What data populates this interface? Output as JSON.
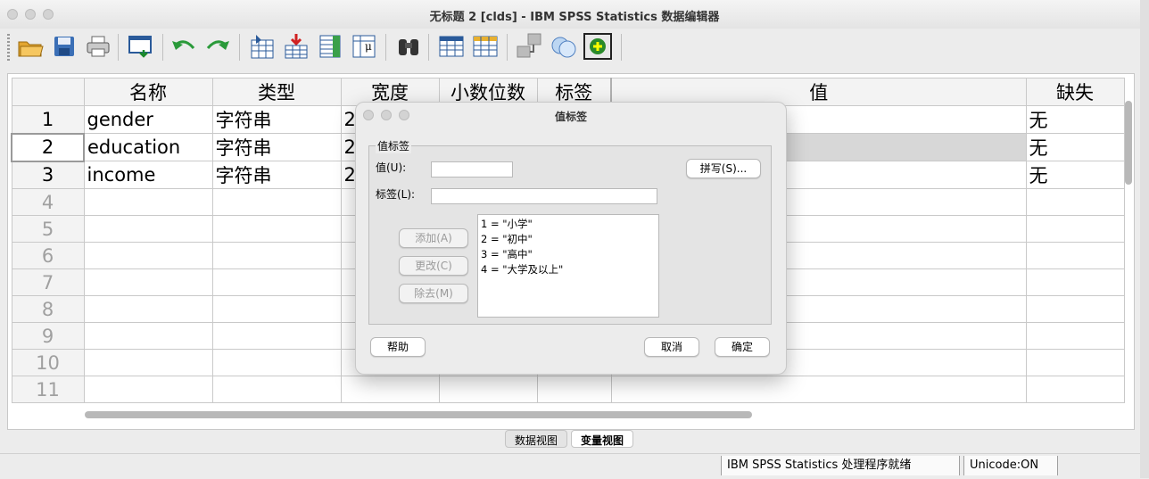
{
  "window": {
    "title": "无标题 2 [clds] - IBM SPSS Statistics 数据编辑器"
  },
  "toolbar": {
    "icons": [
      "open-folder-icon",
      "save-icon",
      "print-icon",
      "recall-dialog-icon",
      "undo-icon",
      "redo-icon",
      "goto-case-icon",
      "goto-variable-icon",
      "variables-icon",
      "run-descriptives-icon",
      "find-icon",
      "insert-cases-icon",
      "insert-variable-icon",
      "split-file-icon",
      "weight-cases-icon",
      "select-cases-icon",
      "value-labels-icon",
      "use-sets-icon"
    ]
  },
  "grid": {
    "headers": [
      "名称",
      "类型",
      "宽度",
      "小数位数",
      "标签",
      "值",
      "缺失"
    ],
    "rows": [
      {
        "num": "1",
        "name": "gender",
        "type": "字符串",
        "width": "2",
        "missing": "无"
      },
      {
        "num": "2",
        "name": "education",
        "type": "字符串",
        "width": "2",
        "missing": "无"
      },
      {
        "num": "3",
        "name": "income",
        "type": "字符串",
        "width": "2",
        "missing": "无"
      },
      {
        "num": "4"
      },
      {
        "num": "5"
      },
      {
        "num": "6"
      },
      {
        "num": "7"
      },
      {
        "num": "8"
      },
      {
        "num": "9"
      },
      {
        "num": "10"
      },
      {
        "num": "11"
      }
    ]
  },
  "tabs": {
    "data_view": "数据视图",
    "variable_view": "变量视图"
  },
  "status": {
    "processor": "IBM SPSS Statistics 处理程序就绪",
    "unicode": "Unicode:ON"
  },
  "dialog": {
    "title": "值标签",
    "group_label": "值标签",
    "value_label": "值(U):",
    "label_label": "标签(L):",
    "value_input": "",
    "label_input": "",
    "spelling_button": "拼写(S)...",
    "add_button": "添加(A)",
    "change_button": "更改(C)",
    "remove_button": "除去(M)",
    "list": [
      "1 = \"小学\"",
      "2 = \"初中\"",
      "3 = \"高中\"",
      "4 = \"大学及以上\""
    ],
    "help_button": "帮助",
    "cancel_button": "取消",
    "ok_button": "确定"
  }
}
